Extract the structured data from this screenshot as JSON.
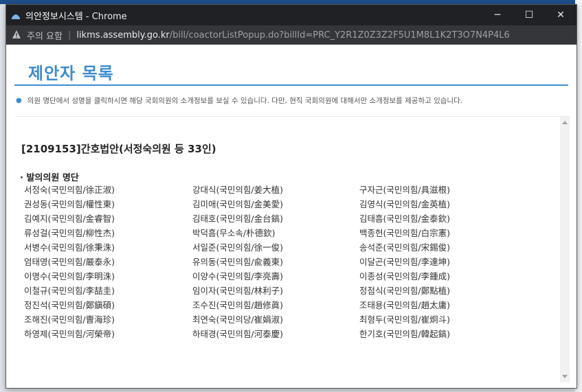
{
  "window": {
    "title_app": "의안정보시스템",
    "title_browser": " - Chrome",
    "controls": {
      "minimize": "─",
      "maximize": "☐",
      "close": "✕"
    }
  },
  "address": {
    "warning": "주의 요함",
    "separator": "|",
    "host": "likms.assembly.go.kr",
    "path": "/bill/coactorListPopup.do?billId=PRC_Y2R1Z0Z3Z2F5U1M8L1K2T3O7N4P4L6"
  },
  "page": {
    "heading": "제안자 목록",
    "notice": "의원 명단에서 성명을 클릭하시면 해당 국회의원의 소개정보를 보실 수 있습니다. 다만, 현직 국회의원에 대해서만 소개정보를 제공하고 있습니다.",
    "bill_title": "[2109153]간호법안(서정숙의원 등 33인)",
    "section_label": "· 발의의원 명단",
    "members": [
      "서정숙(국민의힘/徐正淑)",
      "강대식(국민의힘/姜大植)",
      "구자근(국민의힘/具滋根)",
      "권성동(국민의힘/權性東)",
      "김미애(국민의힘/金美愛)",
      "김영식(국민의힘/金英植)",
      "김예지(국민의힘/金睿智)",
      "김태호(국민의힘/金台鎬)",
      "김태흠(국민의힘/金泰欽)",
      "류성걸(국민의힘/柳性杰)",
      "박덕흠(무소속/朴德欽)",
      "백종헌(국민의힘/白宗憲)",
      "서병수(국민의힘/徐秉洙)",
      "서일준(국민의힘/徐一俊)",
      "송석준(국민의힘/宋錫俊)",
      "엄태영(국민의힘/嚴泰永)",
      "유의동(국민의힘/兪義東)",
      "이달곤(국민의힘/李達坤)",
      "이명수(국민의힘/李明洙)",
      "이양수(국민의힘/李亮壽)",
      "이종성(국민의힘/李鍾成)",
      "이철규(국민의힘/李喆圭)",
      "임이자(국민의힘/林利子)",
      "정점식(국민의힘/鄭點植)",
      "정진석(국민의힘/鄭鎭碩)",
      "조수진(국민의힘/趙修眞)",
      "조태용(국민의힘/趙太庸)",
      "조해진(국민의힘/曺海珍)",
      "최연숙(국민의당/崔娟淑)",
      "최형두(국민의힘/崔炯斗)",
      "하영제(국민의힘/河榮帝)",
      "하태경(국민의힘/河泰慶)",
      "한기호(국민의힘/韓起鎬)"
    ]
  },
  "colors": {
    "accent": "#3f8bd0",
    "titlebar": "#202124",
    "addressbar": "#35363a"
  }
}
